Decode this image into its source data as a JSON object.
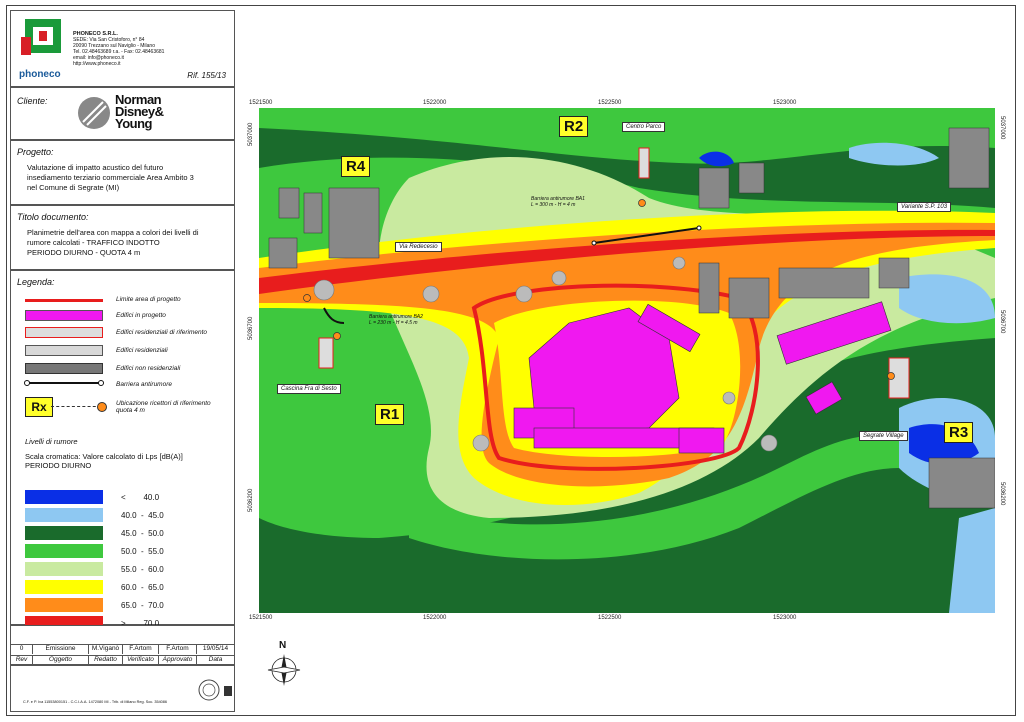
{
  "company": {
    "logo_text": "phoneco",
    "name": "PHONECO S.R.L.",
    "line1": "SEDE: Via San Cristoforo, n° 84",
    "line2": "20090 Trezzano sul Naviglio - Milano",
    "line3": "Tel. 02.48463689 r.a. - Fax: 02.48463681",
    "line4": "email: info@phoneco.it",
    "line5": "http://www.phoneco.it",
    "ref": "Rif. 155/13"
  },
  "client": {
    "label": "Cliente:",
    "logo_line1": "Norman",
    "logo_line2": "Disney&",
    "logo_line3": "Young"
  },
  "project": {
    "label": "Progetto:",
    "line1": "Valutazione di impatto acustico del futuro",
    "line2": "insediamento terziario commerciale Area Ambito 3",
    "line3": "nel Comune di Segrate (MI)"
  },
  "doc_title": {
    "label": "Titolo documento:",
    "line1": "Planimetrie dell'area con mappa a colori dei livelli di",
    "line2": "rumore calcolati - TRAFFICO INDOTTO",
    "line3": "PERIODO DIURNO - QUOTA 4 m"
  },
  "legend": {
    "label": "Legenda:",
    "items": [
      {
        "label": "Limite area di progetto"
      },
      {
        "label": "Edifici in progetto"
      },
      {
        "label": "Edifici residenziali di riferimento"
      },
      {
        "label": "Edifici residenziali"
      },
      {
        "label": "Edifici non residenziali"
      },
      {
        "label": "Barriera antirumore"
      }
    ],
    "rx_box": "Rx",
    "rx_line1": "Ubicazione ricettori di riferimento",
    "rx_line2": "quota 4 m"
  },
  "noise": {
    "title": "Livelli di rumore",
    "subtitle1": "Scala cromatica: Valore calcolato di Lps [dB(A)]",
    "subtitle2": "PERIODO DIURNO",
    "scale": [
      {
        "color": "#0a2fe6",
        "label": "<        40.0"
      },
      {
        "color": "#8ec8f2",
        "label": "40.0  -  45.0"
      },
      {
        "color": "#1a6b2c",
        "label": "45.0  -  50.0"
      },
      {
        "color": "#3ec83e",
        "label": "50.0  -  55.0"
      },
      {
        "color": "#c9eaa0",
        "label": "55.0  -  60.0"
      },
      {
        "color": "#ffff00",
        "label": "60.0  -  65.0"
      },
      {
        "color": "#ff8c1a",
        "label": "65.0  -  70.0"
      },
      {
        "color": "#e81d1d",
        "label": ">        70.0"
      }
    ]
  },
  "revision": {
    "values": [
      "0",
      "Emissione",
      "M.Viganò",
      "F.Artom",
      "F.Artom",
      "19/05/14"
    ],
    "headers": [
      "Rev",
      "Oggetto",
      "Redatto",
      "Verificato",
      "Approvato",
      "Data"
    ]
  },
  "footer_text": "C.F. e P. Iva 11553800151 - C.C.I.A.A. 1472080 MI - Trib. di Milano Reg. Soc. 354086",
  "map": {
    "x_ticks": [
      "1521500",
      "1522000",
      "1522500",
      "1523000"
    ],
    "y_ticks_left": [
      "5037000",
      "5036700",
      "5036200"
    ],
    "y_ticks_right": [
      "5037000",
      "5036700",
      "5036200"
    ],
    "receivers": [
      "R1",
      "R2",
      "R3",
      "R4"
    ],
    "labels": {
      "centro_parco": "Centro Parco",
      "variante": "Variante S.P. 103",
      "via_redecesio": "Via Redecesio",
      "cascina": "Cascina Fra di Sesto",
      "segrate_village": "Segrate Village",
      "ba1_line1": "Barriera antirumore BA1",
      "ba1_line2": "L = 300 m - H = 4 m",
      "ba2_line1": "Barriera antirumore BA2",
      "ba2_line2": "L = 230 m - H = 4.5 m"
    },
    "north": "N"
  }
}
